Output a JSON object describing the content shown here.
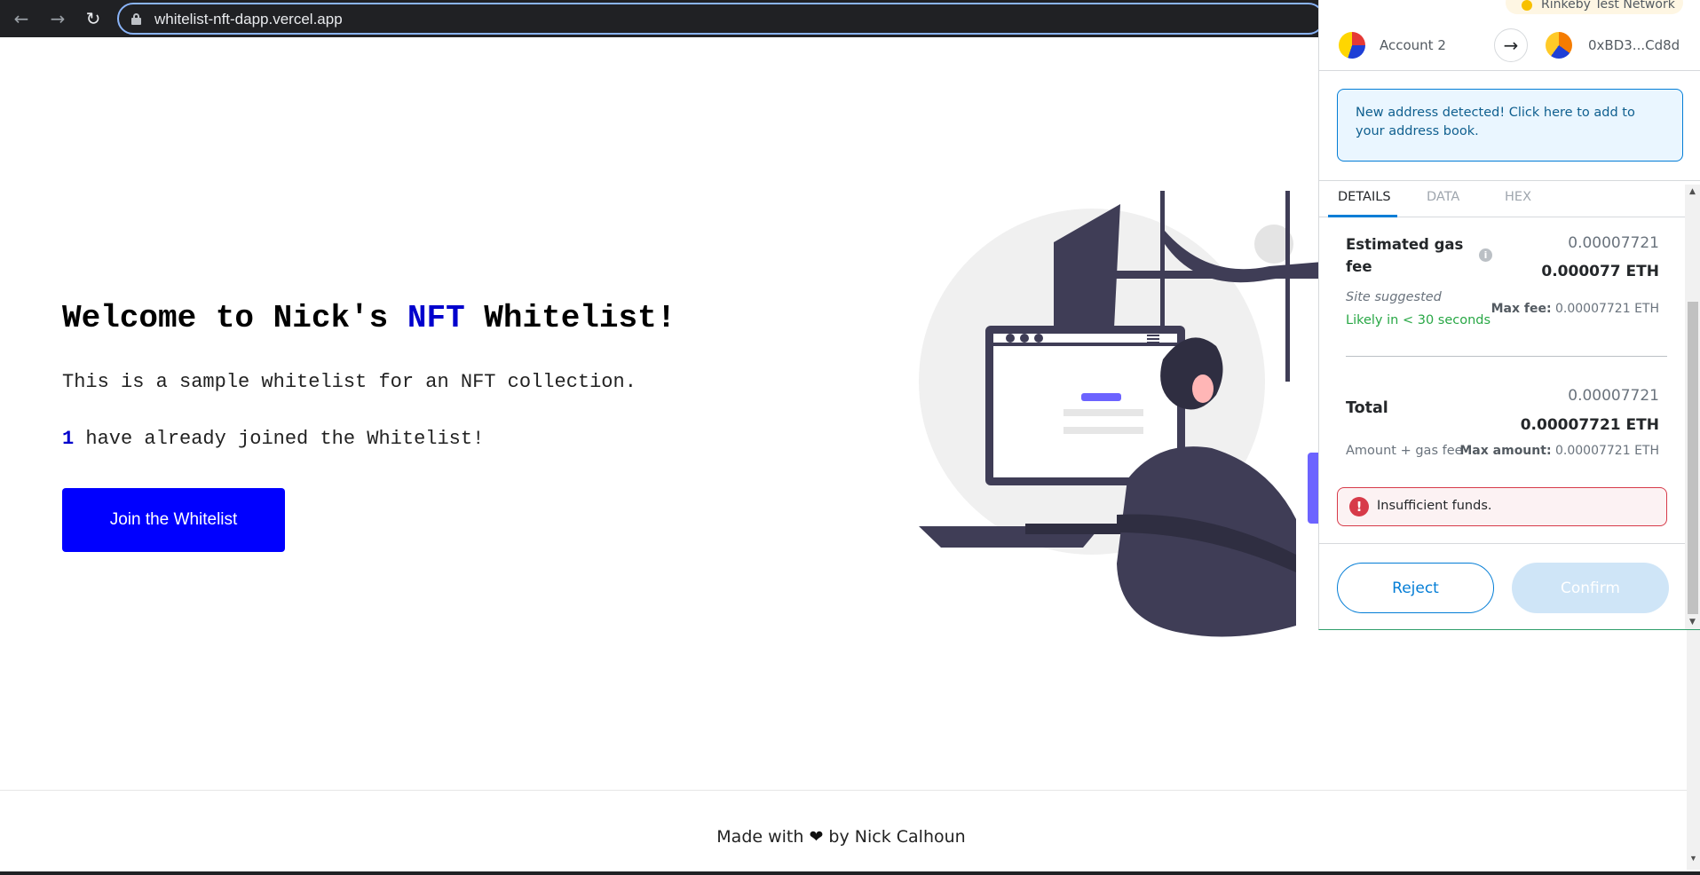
{
  "browser": {
    "url": "whitelist-nft-dapp.vercel.app",
    "back_icon": "arrow-left-icon",
    "forward_icon": "arrow-right-icon",
    "reload_icon": "reload-icon"
  },
  "hero": {
    "title_prefix": "Welcome to Nick's ",
    "title_highlight": "NFT",
    "title_suffix": " Whitelist!",
    "description": "This is a sample whitelist for an NFT collection.",
    "joined_count": "1",
    "joined_suffix": " have already joined the Whitelist!",
    "join_button": "Join the Whitelist"
  },
  "footer": {
    "prefix": "Made with ",
    "suffix": " by Nick Calhoun"
  },
  "metamask": {
    "network": "Rinkeby Test Network",
    "from_account": "Account 2",
    "to_address": "0xBD3...Cd8d",
    "notice": "New address detected! Click here to add to your address book.",
    "tabs": [
      "DETAILS",
      "DATA",
      "HEX"
    ],
    "gas": {
      "label": "Estimated gas fee",
      "value": "0.00007721",
      "value_eth": "0.000077 ETH",
      "site_suggested": "Site suggested",
      "likely": "Likely in < 30 seconds",
      "max_fee_label": "Max fee:",
      "max_fee_value": "0.00007721 ETH"
    },
    "total": {
      "label": "Total",
      "value": "0.00007721",
      "value_eth": "0.00007721 ETH",
      "amount_gas": "Amount + gas fee",
      "max_amount_label": "Max amount:",
      "max_amount_value": "0.00007721 ETH"
    },
    "error": "Insufficient funds.",
    "reject": "Reject",
    "confirm": "Confirm"
  }
}
